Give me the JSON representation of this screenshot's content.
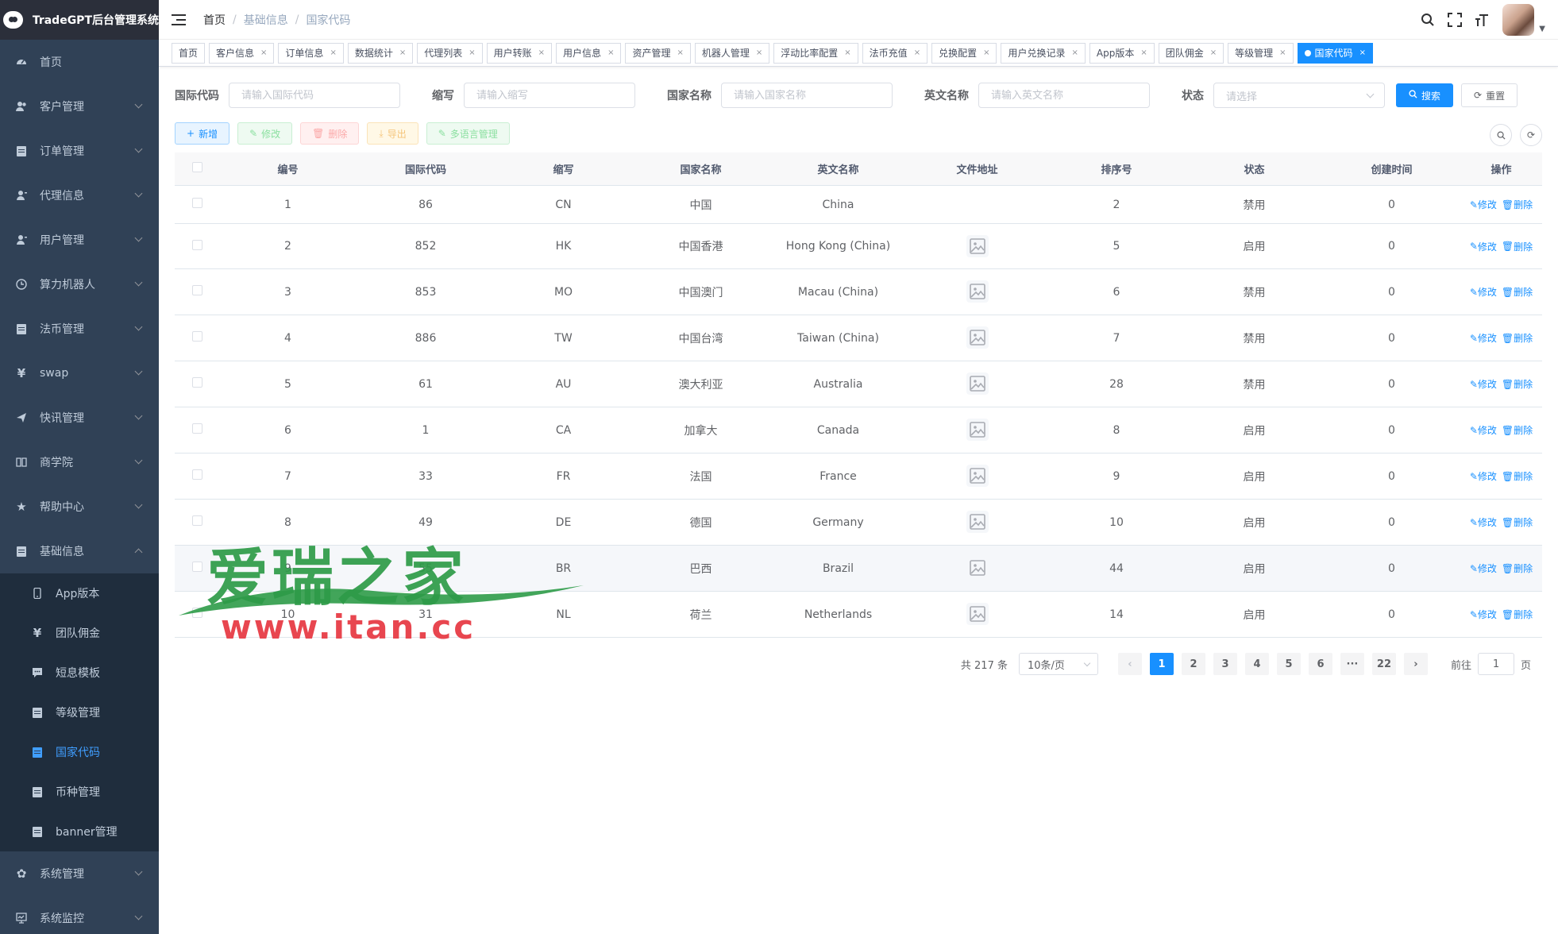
{
  "app": {
    "title": "TradeGPT后台管理系统"
  },
  "sidebar": {
    "items": [
      {
        "label": "首页",
        "icon": "dashboard-icon",
        "arrow": false
      },
      {
        "label": "客户管理",
        "icon": "users-icon",
        "arrow": true
      },
      {
        "label": "订单管理",
        "icon": "document-icon",
        "arrow": true
      },
      {
        "label": "代理信息",
        "icon": "user-icon",
        "arrow": true
      },
      {
        "label": "用户管理",
        "icon": "user-icon",
        "arrow": true
      },
      {
        "label": "算力机器人",
        "icon": "clock-icon",
        "arrow": true
      },
      {
        "label": "法币管理",
        "icon": "document-icon",
        "arrow": true
      },
      {
        "label": "swap",
        "icon": "yen-icon",
        "arrow": true
      },
      {
        "label": "快讯管理",
        "icon": "send-icon",
        "arrow": true
      },
      {
        "label": "商学院",
        "icon": "book-icon",
        "arrow": true
      },
      {
        "label": "帮助中心",
        "icon": "star-icon",
        "arrow": true
      },
      {
        "label": "基础信息",
        "icon": "document-icon",
        "arrow": true,
        "expanded": true
      }
    ],
    "subitems": [
      {
        "label": "App版本",
        "icon": "phone-icon"
      },
      {
        "label": "团队佣金",
        "icon": "yen-icon"
      },
      {
        "label": "短息模板",
        "icon": "message-icon"
      },
      {
        "label": "等级管理",
        "icon": "document-icon"
      },
      {
        "label": "国家代码",
        "icon": "document-icon",
        "active": true
      },
      {
        "label": "币种管理",
        "icon": "document-icon"
      },
      {
        "label": "banner管理",
        "icon": "document-icon"
      }
    ],
    "bottom": [
      {
        "label": "系统管理",
        "icon": "gear-icon"
      },
      {
        "label": "系统监控",
        "icon": "monitor-icon"
      }
    ]
  },
  "breadcrumb": [
    "首页",
    "基础信息",
    "国家代码"
  ],
  "tags": [
    "首页",
    "客户信息",
    "订单信息",
    "数据统计",
    "代理列表",
    "用户转账",
    "用户信息",
    "资产管理",
    "机器人管理",
    "浮动比率配置",
    "法币充值",
    "兑换配置",
    "用户兑换记录",
    "App版本",
    "团队佣金",
    "等级管理",
    "国家代码"
  ],
  "search": {
    "code_label": "国际代码",
    "code_placeholder": "请输入国际代码",
    "abbr_label": "缩写",
    "abbr_placeholder": "请输入缩写",
    "name_label": "国家名称",
    "name_placeholder": "请输入国家名称",
    "en_label": "英文名称",
    "en_placeholder": "请输入英文名称",
    "status_label": "状态",
    "status_placeholder": "请选择",
    "search_btn": "搜索",
    "reset_btn": "重置"
  },
  "toolbar": {
    "add": "新增",
    "edit": "修改",
    "delete": "删除",
    "export": "导出",
    "lang": "多语言管理"
  },
  "table": {
    "headers": [
      "编号",
      "国际代码",
      "缩写",
      "国家名称",
      "英文名称",
      "文件地址",
      "排序号",
      "状态",
      "创建时间",
      "操作"
    ],
    "edit_label": "修改",
    "delete_label": "删除",
    "rows": [
      {
        "id": "1",
        "code": "86",
        "abbr": "CN",
        "name": "中国",
        "en": "China",
        "img": false,
        "sort": "2",
        "status": "禁用",
        "created": "0"
      },
      {
        "id": "2",
        "code": "852",
        "abbr": "HK",
        "name": "中国香港",
        "en": "Hong Kong (China)",
        "img": true,
        "sort": "5",
        "status": "启用",
        "created": "0"
      },
      {
        "id": "3",
        "code": "853",
        "abbr": "MO",
        "name": "中国澳门",
        "en": "Macau (China)",
        "img": true,
        "sort": "6",
        "status": "禁用",
        "created": "0"
      },
      {
        "id": "4",
        "code": "886",
        "abbr": "TW",
        "name": "中国台湾",
        "en": "Taiwan (China)",
        "img": true,
        "sort": "7",
        "status": "禁用",
        "created": "0"
      },
      {
        "id": "5",
        "code": "61",
        "abbr": "AU",
        "name": "澳大利亚",
        "en": "Australia",
        "img": true,
        "sort": "28",
        "status": "禁用",
        "created": "0"
      },
      {
        "id": "6",
        "code": "1",
        "abbr": "CA",
        "name": "加拿大",
        "en": "Canada",
        "img": true,
        "sort": "8",
        "status": "启用",
        "created": "0"
      },
      {
        "id": "7",
        "code": "33",
        "abbr": "FR",
        "name": "法国",
        "en": "France",
        "img": true,
        "sort": "9",
        "status": "启用",
        "created": "0"
      },
      {
        "id": "8",
        "code": "49",
        "abbr": "DE",
        "name": "德国",
        "en": "Germany",
        "img": true,
        "sort": "10",
        "status": "启用",
        "created": "0"
      },
      {
        "id": "9",
        "code": "55",
        "abbr": "BR",
        "name": "巴西",
        "en": "Brazil",
        "img": true,
        "sort": "44",
        "status": "启用",
        "created": "0",
        "highlight": true
      },
      {
        "id": "10",
        "code": "31",
        "abbr": "NL",
        "name": "荷兰",
        "en": "Netherlands",
        "img": true,
        "sort": "14",
        "status": "启用",
        "created": "0"
      }
    ]
  },
  "pagination": {
    "total": "共 217 条",
    "page_size": "10条/页",
    "pages": [
      "1",
      "2",
      "3",
      "4",
      "5",
      "6",
      "···",
      "22"
    ],
    "current": "1",
    "goto_prefix": "前往",
    "goto_value": "1",
    "goto_suffix": "页"
  },
  "watermark": {
    "main": "爱瑞之家",
    "url": "www.itan.cc"
  },
  "colors": {
    "primary": "#1890ff",
    "sidebar_bg": "#304156",
    "submenu_bg": "#1f2d3d"
  }
}
